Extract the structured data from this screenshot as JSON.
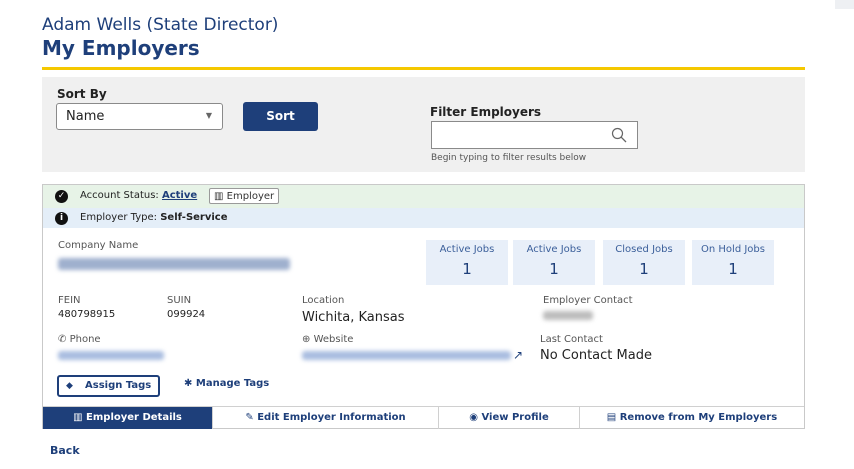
{
  "header": {
    "user": "Adam Wells (State Director)",
    "title": "My Employers"
  },
  "sort": {
    "label": "Sort By",
    "selected": "Name",
    "button": "Sort"
  },
  "filter": {
    "label": "Filter Employers",
    "value": "",
    "hint": "Begin typing to filter results below"
  },
  "card": {
    "status_label": "Account Status:",
    "status_value": "Active",
    "badge": "Employer",
    "type_label": "Employer Type:",
    "type_value": "Self-Service",
    "company_label": "Company Name",
    "jobs": [
      {
        "label": "Active Jobs",
        "count": "1"
      },
      {
        "label": "Active Jobs",
        "count": "1"
      },
      {
        "label": "Closed Jobs",
        "count": "1"
      },
      {
        "label": "On Hold Jobs",
        "count": "1"
      }
    ],
    "fein_label": "FEIN",
    "fein_value": "480798915",
    "suin_label": "SUIN",
    "suin_value": "099924",
    "location_label": "Location",
    "location_value": "Wichita, Kansas",
    "contact_label": "Employer Contact",
    "phone_label": "Phone",
    "website_label": "Website",
    "last_contact_label": "Last Contact",
    "last_contact_value": "No Contact Made",
    "assign_tags": "Assign Tags",
    "manage_tags": "Manage Tags",
    "actions": {
      "details": "Employer Details",
      "edit": "Edit Employer Information",
      "profile": "View Profile",
      "remove": "Remove from My Employers"
    }
  },
  "back": "Back",
  "colors": {
    "brand_blue": "#1e3f7a",
    "accent_yellow": "#f5c800",
    "status_green_bg": "#e7f3e7",
    "type_blue_bg": "#e4eef8"
  }
}
